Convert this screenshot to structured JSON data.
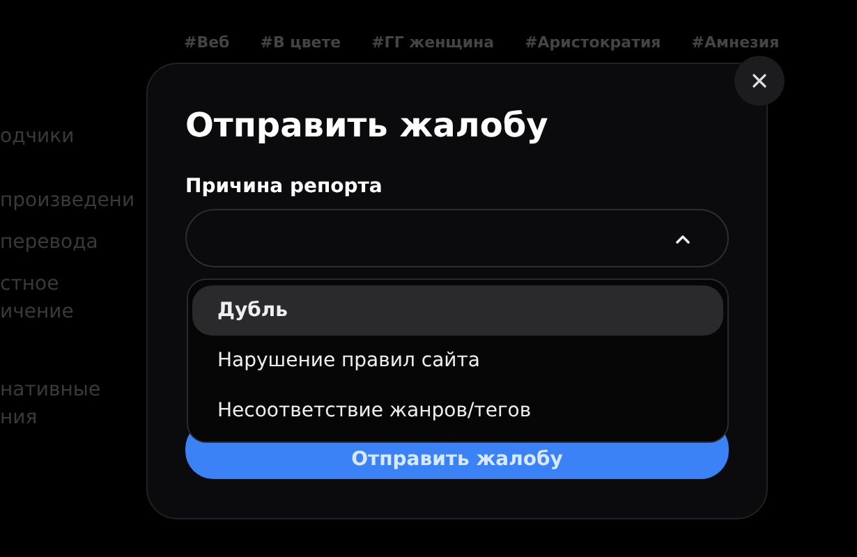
{
  "page": {
    "sidebar_items": [
      "одчики",
      "произведени",
      "перевода",
      "стное\nичение",
      "нативные\nния"
    ],
    "tags": [
      "#Веб",
      "#В цвете",
      "#ГГ женщина",
      "#Аристократия",
      "#Амнезия"
    ]
  },
  "modal": {
    "title": "Отправить жалобу",
    "field_label": "Причина репорта",
    "select": {
      "expanded": true,
      "options": [
        {
          "label": "Дубль",
          "selected": true
        },
        {
          "label": "Нарушение правил сайта",
          "selected": false
        },
        {
          "label": "Несоответствие жанров/тегов",
          "selected": false
        }
      ]
    },
    "submit_button": "Отправить жалобу"
  }
}
